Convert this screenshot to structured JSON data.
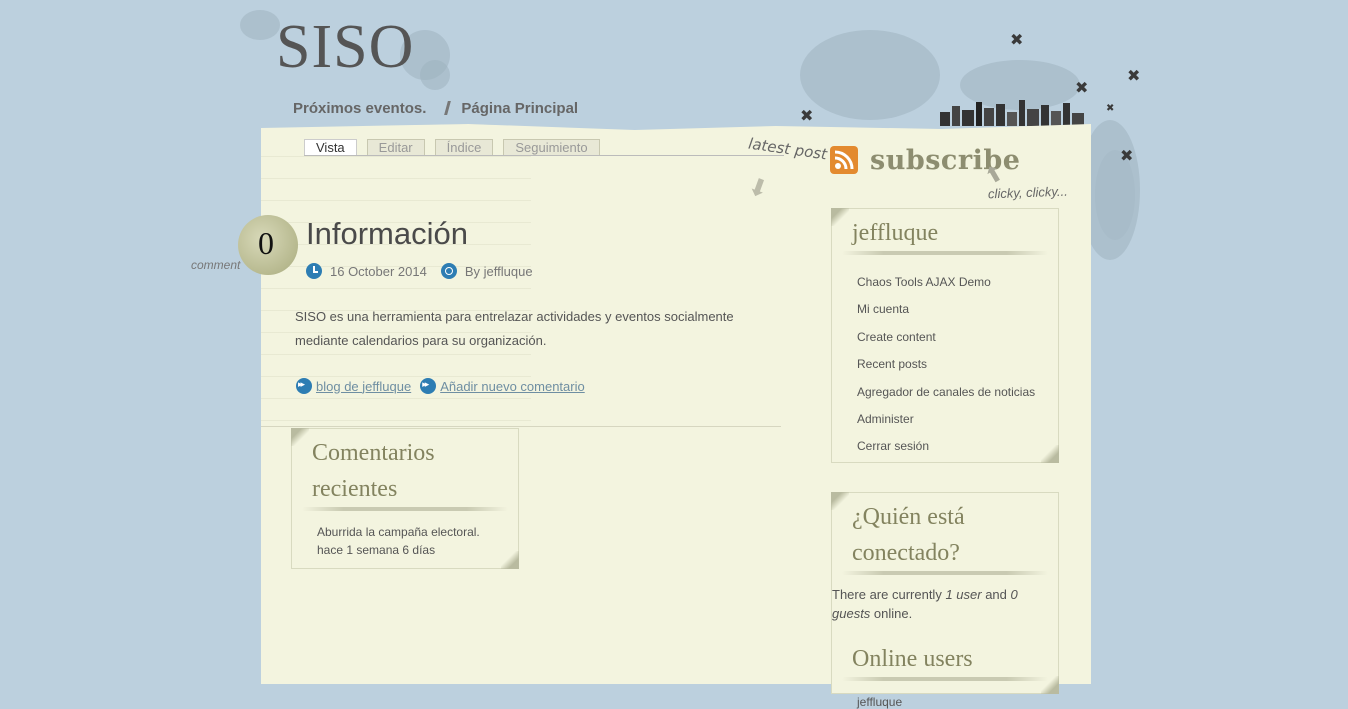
{
  "site": {
    "title": "SISO"
  },
  "primary_nav": [
    "Próximos eventos.",
    "Página Principal"
  ],
  "tabs": [
    {
      "label": "Vista",
      "active": true
    },
    {
      "label": "Editar",
      "active": false
    },
    {
      "label": "Índice",
      "active": false
    },
    {
      "label": "Seguimiento",
      "active": false
    }
  ],
  "banner": {
    "latest_post": "latest post",
    "subscribe": "subscribe",
    "clicky": "clicky, clicky..."
  },
  "node": {
    "comment_count": "0",
    "comment_label": "comment",
    "title": "Información",
    "date": "16 October 2014",
    "author": "By jeffluque",
    "body": "SISO es una herramienta para entrelazar actividades y eventos socialmente mediante calendarios para su organización.",
    "links": [
      "blog de jeffluque",
      "Añadir nuevo comentario"
    ]
  },
  "recent_comments": {
    "title": "Comentarios recientes",
    "item_text": "Aburrida la campaña electoral.",
    "item_time": "hace 1 semana 6 días"
  },
  "user_block": {
    "title": "jeffluque",
    "items": [
      "Chaos Tools AJAX Demo",
      "Mi cuenta",
      "Create content",
      "Recent posts",
      "Agregador de canales de noticias",
      "Administer",
      "Cerrar sesión"
    ]
  },
  "who_online": {
    "title": "¿Quién está conectado?",
    "text_prefix": "There are currently ",
    "users": "1 user",
    "text_mid": " and ",
    "guests": "0 guests",
    "text_suffix": " online.",
    "online_title": "Online users",
    "online_users": [
      "jeffluque"
    ]
  },
  "colors": {
    "background": "#bcd0de",
    "paper": "#f3f4df",
    "accent_icon": "#2d7db3",
    "link": "#6e8ea2",
    "heading": "#83835f"
  }
}
